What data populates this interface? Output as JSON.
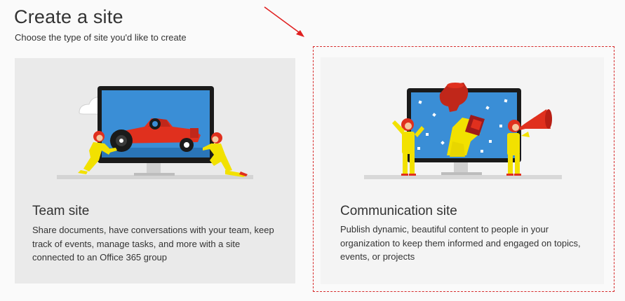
{
  "header": {
    "title": "Create a site",
    "subtitle": "Choose the type of site you'd like to create"
  },
  "cards": [
    {
      "title": "Team site",
      "description": "Share documents, have conversations with your team, keep track of events, manage tasks, and more with a site connected to an Office 365 group",
      "illustration": "race-car-illustration"
    },
    {
      "title": "Communication site",
      "description": "Publish dynamic, beautiful content to people in your organization to keep them informed and engaged on topics, events, or projects",
      "illustration": "trophy-megaphone-illustration"
    }
  ],
  "annotation": {
    "outline_color": "#d62b2b",
    "arrow_color": "#e02020",
    "highlighted_card": "Communication site"
  },
  "colors": {
    "screen_blue": "#3a8ed6",
    "figure_yellow": "#f2e100",
    "accent_red": "#e0301e",
    "dark_frame": "#1a1a1a"
  }
}
